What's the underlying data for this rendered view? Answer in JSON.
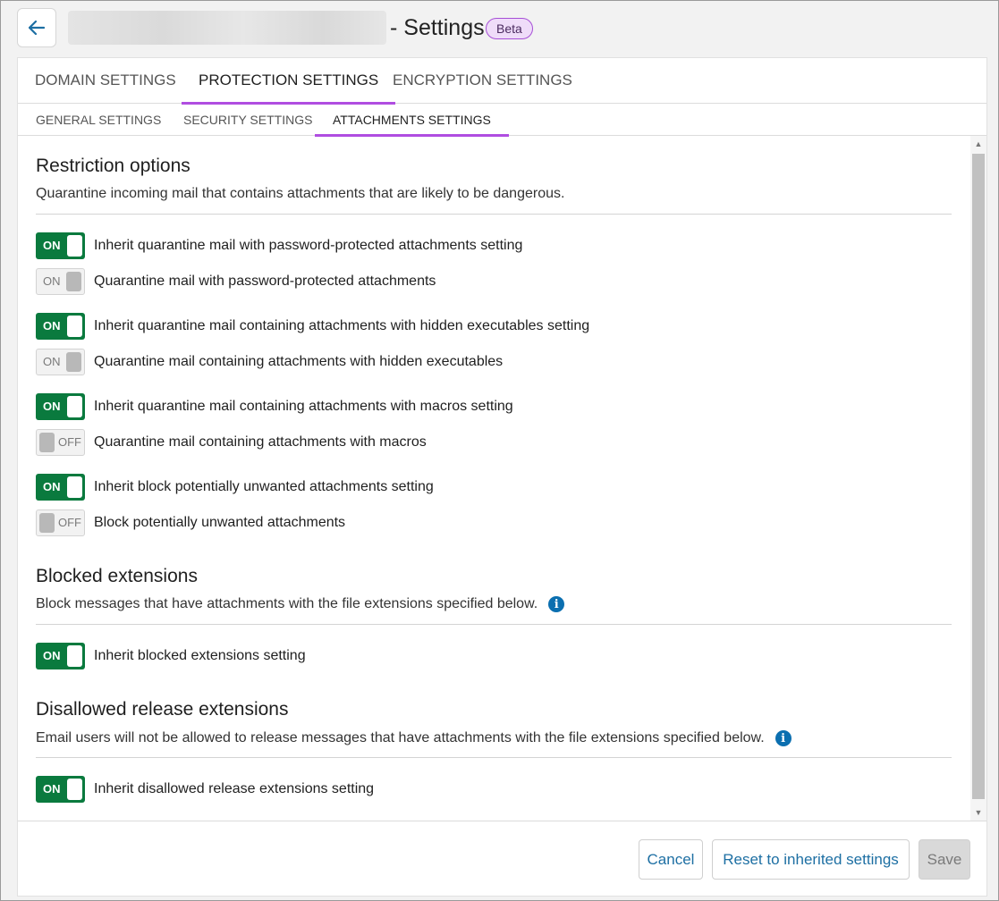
{
  "header": {
    "title_suffix": "- Settings",
    "badge": "Beta"
  },
  "main_tabs": [
    {
      "label": "DOMAIN SETTINGS",
      "active": false
    },
    {
      "label": "PROTECTION SETTINGS",
      "active": true
    },
    {
      "label": "ENCRYPTION SETTINGS",
      "active": false
    }
  ],
  "sub_tabs": [
    {
      "label": "GENERAL SETTINGS",
      "active": false
    },
    {
      "label": "SECURITY SETTINGS",
      "active": false
    },
    {
      "label": "ATTACHMENTS SETTINGS",
      "active": true
    }
  ],
  "sections": {
    "restriction": {
      "title": "Restriction options",
      "description": "Quarantine incoming mail that contains attachments that are likely to be dangerous.",
      "rows": [
        {
          "label": "Inherit quarantine mail with password-protected attachments setting",
          "toggle": "ON",
          "enabled": true
        },
        {
          "label": "Quarantine mail with password-protected attachments",
          "toggle": "ON",
          "enabled": false
        },
        {
          "label": "Inherit quarantine mail containing attachments with hidden executables setting",
          "toggle": "ON",
          "enabled": true
        },
        {
          "label": "Quarantine mail containing attachments with hidden executables",
          "toggle": "ON",
          "enabled": false
        },
        {
          "label": "Inherit quarantine mail containing attachments with macros setting",
          "toggle": "ON",
          "enabled": true
        },
        {
          "label": "Quarantine mail containing attachments with macros",
          "toggle": "OFF",
          "enabled": false
        },
        {
          "label": "Inherit block potentially unwanted attachments setting",
          "toggle": "ON",
          "enabled": true
        },
        {
          "label": "Block potentially unwanted attachments",
          "toggle": "OFF",
          "enabled": false
        }
      ]
    },
    "blocked": {
      "title": "Blocked extensions",
      "description": "Block messages that have attachments with the file extensions specified below.",
      "rows": [
        {
          "label": "Inherit blocked extensions setting",
          "toggle": "ON",
          "enabled": true
        }
      ]
    },
    "disallowed": {
      "title": "Disallowed release extensions",
      "description": "Email users will not be allowed to release messages that have attachments with the file extensions specified below.",
      "rows": [
        {
          "label": "Inherit disallowed release extensions setting",
          "toggle": "ON",
          "enabled": true
        }
      ]
    }
  },
  "footer": {
    "cancel": "Cancel",
    "reset": "Reset to inherited settings",
    "save": "Save"
  },
  "info_icon_glyph": "i",
  "colors": {
    "accent": "#b04de1",
    "toggle_on": "#0a7a3e",
    "link": "#1d6fa3",
    "info": "#0b6fb0"
  }
}
